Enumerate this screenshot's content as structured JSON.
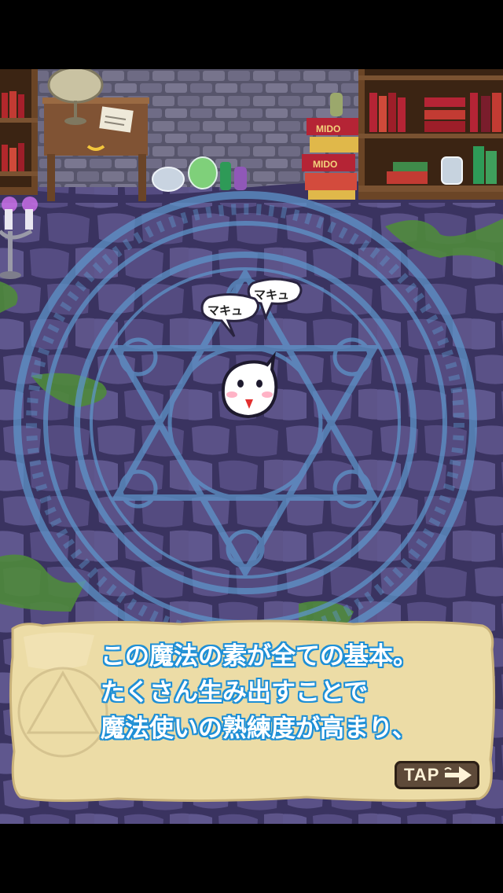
{
  "scene": {
    "name": "magic-room",
    "book_spine_text": "MIDO"
  },
  "speech_bubbles": [
    {
      "text": "マキュ"
    },
    {
      "text": "マキュ"
    }
  ],
  "dialog": {
    "lines": [
      "この魔法の素が全ての基本。",
      "たくさん生み出すことで",
      "魔法使いの熟練度が高まり、"
    ],
    "tap_label": "TAP"
  },
  "colors": {
    "floor": "#4a4372",
    "circle": "#5d94c9",
    "dialog_text_outline": "#1e8fd6",
    "parchment": "#ecdca6"
  }
}
